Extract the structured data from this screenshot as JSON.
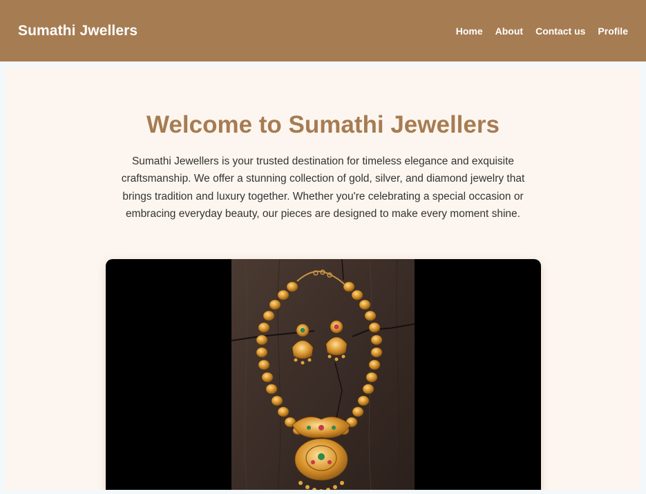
{
  "navbar": {
    "brand": "Sumathi Jwellers",
    "links": [
      {
        "label": "Home"
      },
      {
        "label": "About"
      },
      {
        "label": "Contact us"
      },
      {
        "label": "Profile"
      }
    ]
  },
  "hero": {
    "title": "Welcome to Sumathi Jewellers",
    "description": "Sumathi Jewellers is your trusted destination for timeless elegance and exquisite craftsmanship. We offer a stunning collection of gold, silver, and diamond jewelry that brings tradition and luxury together. Whether you're celebrating a special occasion or embracing everyday beauty, our pieces are designed to make every moment shine."
  },
  "media": {
    "icon": "gold-necklace-and-earrings-image"
  },
  "colors": {
    "nav_background": "#a67c52",
    "accent": "#a67c52",
    "content_background": "#fdf6f0",
    "media_background": "#000000"
  }
}
